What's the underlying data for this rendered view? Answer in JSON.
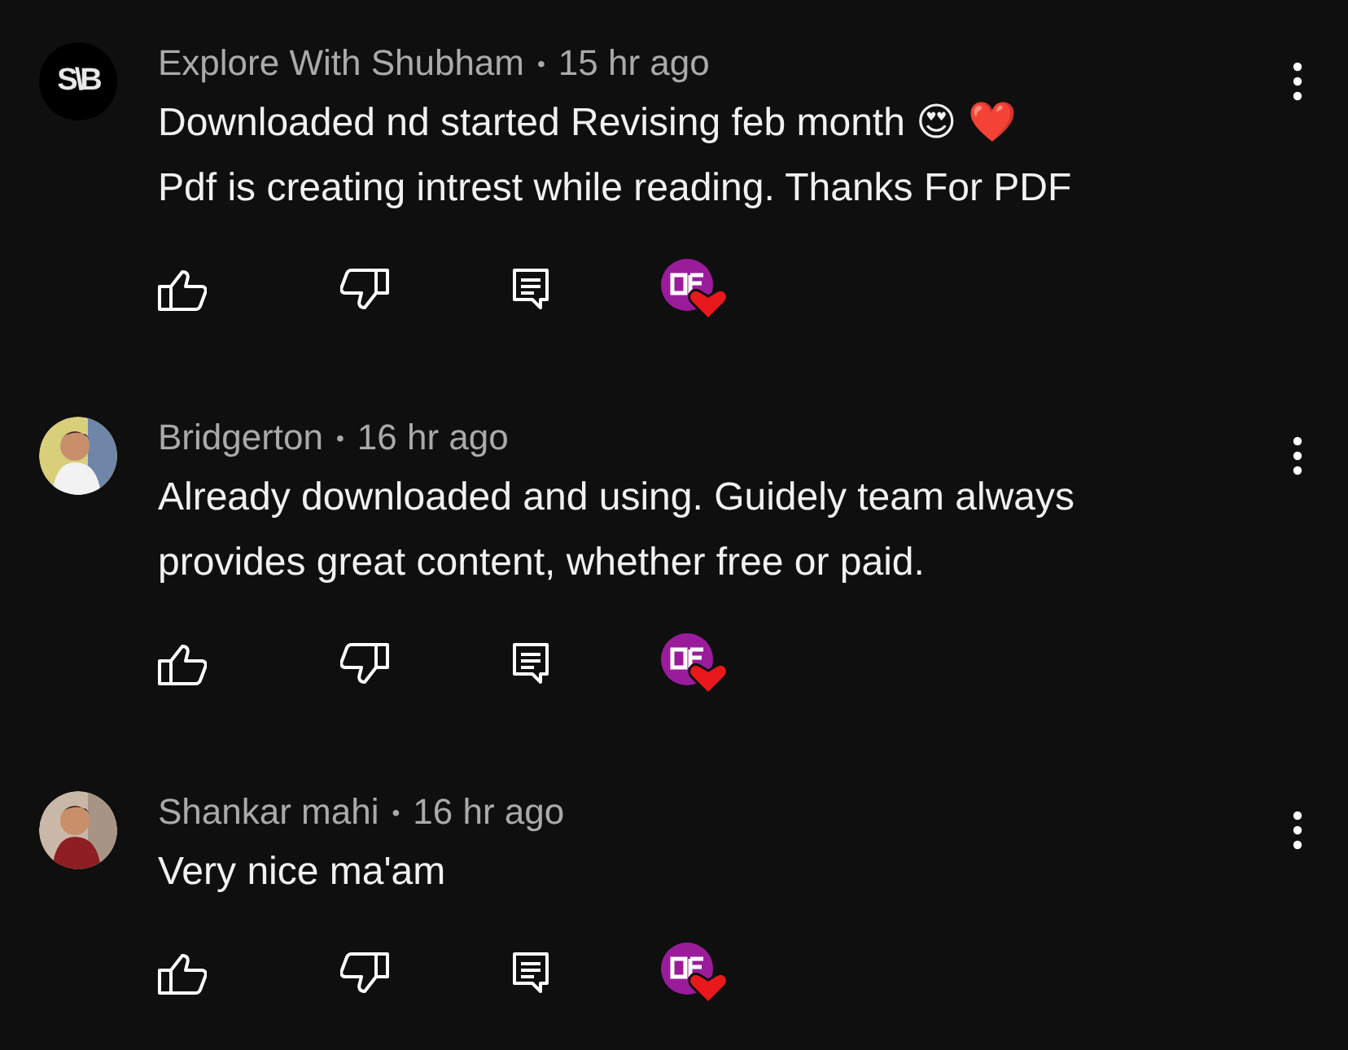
{
  "comments": [
    {
      "author": "Explore With Shubham",
      "separator": "•",
      "time": "15 hr ago",
      "lines": [
        "Downloaded nd started Revising feb month 😍 ❤️",
        "Pdf is creating intrest while reading. Thanks For PDF"
      ],
      "avatar": {
        "kind": "monogram",
        "text": "S\\B"
      },
      "creator_hearted": true
    },
    {
      "author": "Bridgerton",
      "separator": "•",
      "time": "16 hr ago",
      "lines": [
        "Already downloaded and using. Guidely team always",
        "provides great content, whether free or paid."
      ],
      "avatar": {
        "kind": "picture"
      },
      "creator_hearted": true
    },
    {
      "author": "Shankar mahi",
      "separator": "•",
      "time": "16 hr ago",
      "lines": [
        "Very nice ma'am"
      ],
      "avatar": {
        "kind": "picture"
      },
      "creator_hearted": true
    }
  ]
}
